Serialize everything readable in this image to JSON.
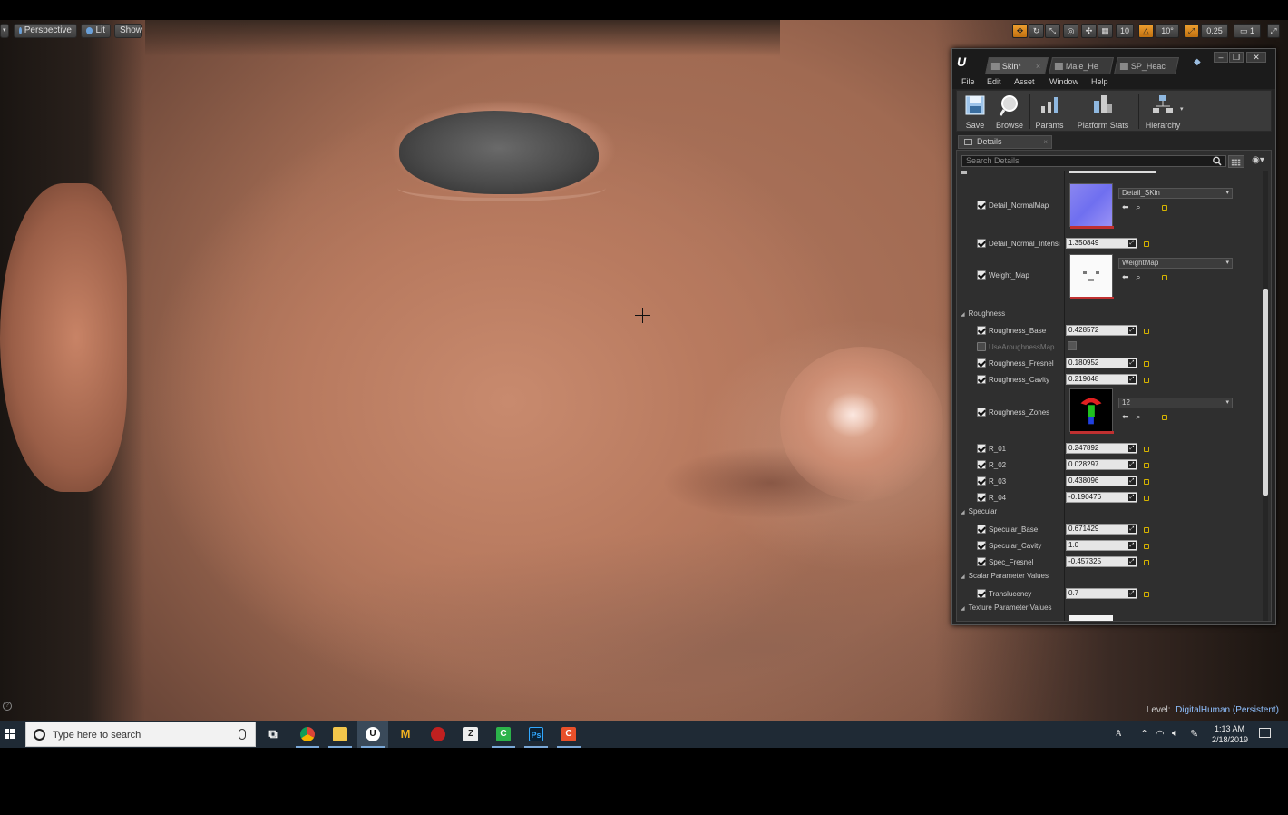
{
  "viewport": {
    "perspective_label": "Perspective",
    "lit_label": "Lit",
    "show_label": "Show",
    "grid_snap_value": "10",
    "rotation_snap_value": "10°",
    "scale_snap_value": "0.25",
    "camera_speed_value": "1",
    "level_prefix": "Level:",
    "level_name": "DigitalHuman (Persistent)"
  },
  "editor": {
    "tabs": [
      {
        "label": "Skin*"
      },
      {
        "label": "Male_He"
      },
      {
        "label": "SP_Heac"
      }
    ],
    "menu": [
      "File",
      "Edit",
      "Asset",
      "Window",
      "Help"
    ],
    "toolbar": {
      "save": "Save",
      "browse": "Browse",
      "params": "Params",
      "platform_stats": "Platform Stats",
      "hierarchy": "Hierarchy"
    },
    "details_tab": "Details",
    "search_placeholder": "Search Details",
    "properties": {
      "detail_normalmap": {
        "name": "Detail_NormalMap",
        "asset": "Detail_SKin"
      },
      "detail_normal_intensity": {
        "name": "Detail_Normal_Intensi",
        "value": "1.350849"
      },
      "weight_map": {
        "name": "Weight_Map",
        "asset": "WeightMap"
      },
      "roughness_category": "Roughness",
      "roughness_base": {
        "name": "Roughness_Base",
        "value": "0.428572"
      },
      "use_roughness_map": {
        "name": "UseAroughnessMap"
      },
      "roughness_fresnel": {
        "name": "Roughness_Fresnel",
        "value": "0.180952"
      },
      "roughness_cavity": {
        "name": "Roughness_Cavity",
        "value": "0.219048"
      },
      "roughness_zones": {
        "name": "Roughness_Zones",
        "asset": "12"
      },
      "r01": {
        "name": "R_01",
        "value": "0.247892"
      },
      "r02": {
        "name": "R_02",
        "value": "0.028297"
      },
      "r03": {
        "name": "R_03",
        "value": "0.438096"
      },
      "r04": {
        "name": "R_04",
        "value": "-0.190476"
      },
      "specular_category": "Specular",
      "specular_base": {
        "name": "Specular_Base",
        "value": "0.671429"
      },
      "specular_cavity": {
        "name": "Specular_Cavity",
        "value": "1.0"
      },
      "spec_fresnel": {
        "name": "Spec_Fresnel",
        "value": "-0.457325"
      },
      "scalar_category": "Scalar Parameter Values",
      "translucency": {
        "name": "Translucency",
        "value": "0.7"
      },
      "texture_category": "Texture Parameter Values"
    }
  },
  "taskbar": {
    "search_placeholder": "Type here to search",
    "apps": [
      "chrome-icon",
      "file-explorer-icon",
      "unreal-engine-icon",
      "marmoset-icon",
      "substance-icon",
      "zbrush-icon",
      "camtasia-icon",
      "photoshop-icon",
      "camtasia-recorder-icon"
    ],
    "time": "1:13 AM",
    "date": "2/18/2019"
  }
}
